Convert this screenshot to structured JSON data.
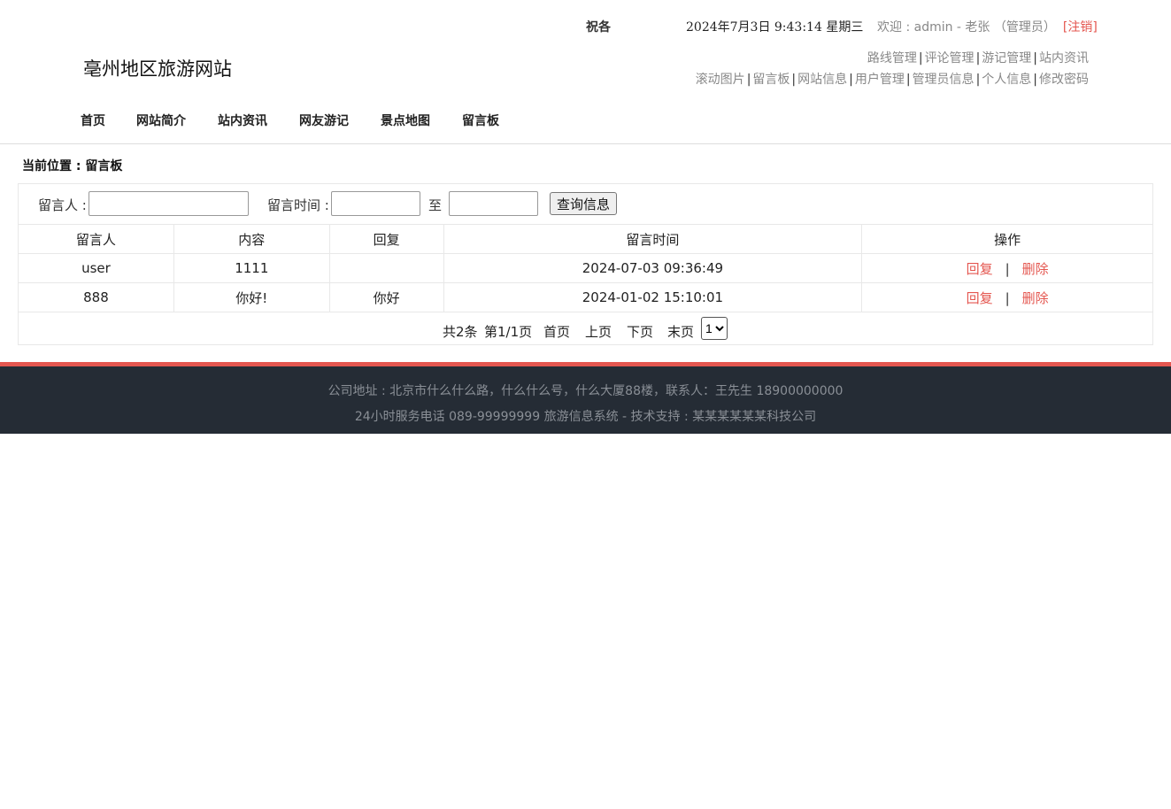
{
  "header": {
    "greeting": "祝各",
    "datetime": "2024年7月3日 9:43:14 星期三",
    "welcome_text": "欢迎 : admin - 老张 （管理员）",
    "logout_label": "[注销]",
    "site_title": "亳州地区旅游网站",
    "admin_links_row1": [
      "路线管理",
      "评论管理",
      "游记管理",
      "站内资讯"
    ],
    "admin_links_row2": [
      "滚动图片",
      "留言板",
      "网站信息",
      "用户管理",
      "管理员信息",
      "个人信息",
      "修改密码"
    ],
    "separator": "|"
  },
  "nav": {
    "items": [
      "首页",
      "网站简介",
      "站内资讯",
      "网友游记",
      "景点地图",
      "留言板"
    ]
  },
  "breadcrumb": "当前位置 : 留言板",
  "search": {
    "author_label": "留言人 :",
    "author_value": "",
    "time_label": "留言时间 :",
    "time_start_value": "",
    "to_label": "至",
    "time_end_value": "",
    "query_button": "查询信息"
  },
  "table": {
    "columns": [
      "留言人",
      "内容",
      "回复",
      "留言时间",
      "操作"
    ],
    "rows": [
      {
        "author": "user",
        "content": "1111",
        "reply": "",
        "time": "2024-07-03 09:36:49"
      },
      {
        "author": "888",
        "content": "你好!",
        "reply": "你好",
        "time": "2024-01-02 15:10:01"
      }
    ],
    "action_reply": "回复",
    "action_delete": "删除",
    "action_sep": "|"
  },
  "pagination": {
    "total": "共2条",
    "page_info": "第1/1页",
    "first": "首页",
    "prev": "上页",
    "next": "下页",
    "last": "末页",
    "selected_page": "1"
  },
  "footer": {
    "line1": "公司地址 : 北京市什么什么路，什么什么号，什么大厦88楼，联系人：王先生 18900000000",
    "line2": "24小时服务电话   089-99999999   旅游信息系统 - 技术支持 : 某某某某某某科技公司"
  },
  "colors": {
    "accent": "#e4564f",
    "footer_bg": "#252c35",
    "link_gray": "#888888"
  }
}
